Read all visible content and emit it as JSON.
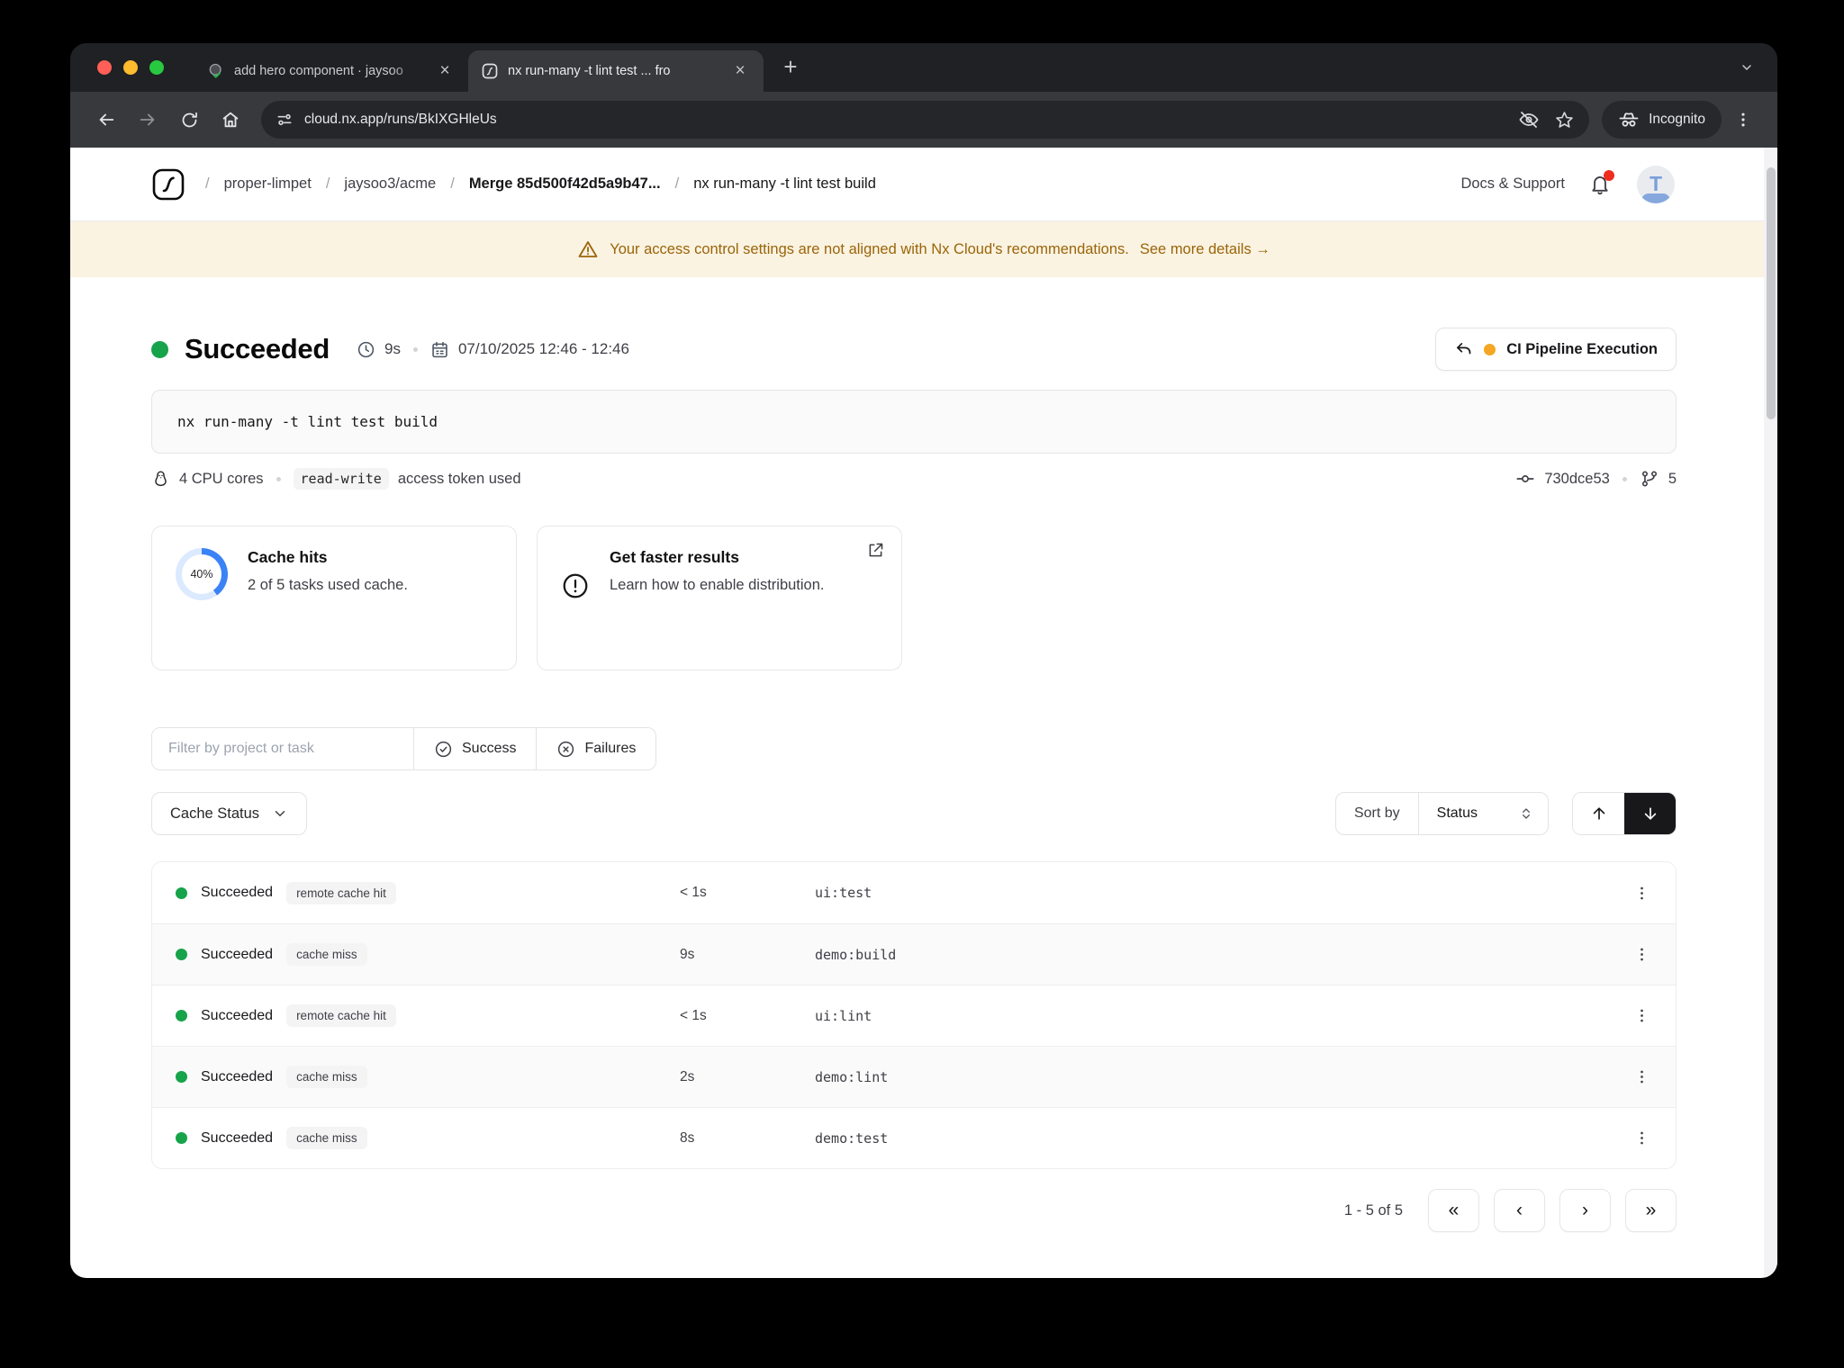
{
  "browser": {
    "tabs": [
      {
        "title": "add hero component · jaysoo",
        "favicon": "pr-check-icon"
      },
      {
        "title": "nx run-many -t lint test ... fro",
        "favicon": "nx-icon"
      }
    ],
    "tab_close": "×",
    "new_tab": "+",
    "url": "cloud.nx.app/runs/BkIXGHleUs",
    "incognito_label": "Incognito"
  },
  "header": {
    "breadcrumb": {
      "separator": "/",
      "items": [
        "proper-limpet",
        "jaysoo3/acme",
        "Merge 85d500f42d5a9b47...",
        "nx run-many -t lint test build"
      ]
    },
    "docs_support": "Docs & Support",
    "avatar_letter": "T"
  },
  "banner": {
    "text": "Your access control settings are not aligned with Nx Cloud's recommendations.",
    "link": "See more details →"
  },
  "run": {
    "status": "Succeeded",
    "duration": "9s",
    "date_range": "07/10/2025 12:46 - 12:46",
    "pipeline_button": "CI Pipeline Execution",
    "command": "nx run-many -t lint test build",
    "cpu": "4 CPU cores",
    "token_badge": "read-write",
    "token_suffix": "access token used",
    "commit": "730dce53",
    "branch_count": "5"
  },
  "cards": {
    "cache": {
      "percent": 40,
      "percent_label": "40%",
      "title": "Cache hits",
      "subtitle": "2 of 5 tasks used cache."
    },
    "faster": {
      "title": "Get faster results",
      "subtitle": "Learn how to enable distribution."
    }
  },
  "filters": {
    "placeholder": "Filter by project or task",
    "success": "Success",
    "failures": "Failures"
  },
  "controls": {
    "cache_status": "Cache Status",
    "sort_by": "Sort by",
    "sort_value": "Status"
  },
  "table": {
    "rows": [
      {
        "status": "Succeeded",
        "badge": "remote cache hit",
        "duration": "< 1s",
        "task": "ui:test"
      },
      {
        "status": "Succeeded",
        "badge": "cache miss",
        "duration": "9s",
        "task": "demo:build"
      },
      {
        "status": "Succeeded",
        "badge": "remote cache hit",
        "duration": "< 1s",
        "task": "ui:lint"
      },
      {
        "status": "Succeeded",
        "badge": "cache miss",
        "duration": "2s",
        "task": "demo:lint"
      },
      {
        "status": "Succeeded",
        "badge": "cache miss",
        "duration": "8s",
        "task": "demo:test"
      }
    ]
  },
  "pagination": {
    "label": "1 - 5 of 5",
    "first": "«",
    "prev": "‹",
    "next": "›",
    "last": "»"
  },
  "colors": {
    "success_green": "#16a34a",
    "donut_blue": "#3b82f6",
    "donut_track": "#dbeafe",
    "banner_bg": "#faf3e2",
    "banner_text": "#9a6509",
    "pipeline_dot": "#f5a623"
  }
}
